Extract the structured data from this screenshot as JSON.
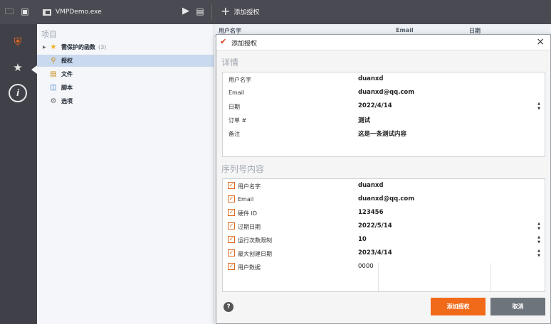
{
  "toolbar": {
    "file_name": "VMPDemo.exe",
    "add_license_label": "添加授权"
  },
  "tree": {
    "heading": "项目",
    "items": [
      {
        "label": "需保护的函数",
        "count": "(3)"
      },
      {
        "label": "授权"
      },
      {
        "label": "文件"
      },
      {
        "label": "脚本"
      },
      {
        "label": "选项"
      }
    ]
  },
  "table_header": {
    "col_user": "用户名字",
    "col_email": "Email",
    "col_date": "日期"
  },
  "dialog": {
    "title": "添加授权",
    "close": "×",
    "details": {
      "title": "详情",
      "rows": [
        {
          "label": "用户名字",
          "value": "duanxd"
        },
        {
          "label": "Email",
          "value": "duanxd@qq.com"
        },
        {
          "label": "日期",
          "value": "2022/4/14"
        },
        {
          "label": "订单 #",
          "value": "测试"
        },
        {
          "label": "备注",
          "value": "这是一条测试内容"
        }
      ]
    },
    "serial": {
      "title": "序列号内容",
      "rows": [
        {
          "label": "用户名字",
          "value": "duanxd",
          "checked": true
        },
        {
          "label": "Email",
          "value": "duanxd@qq.com",
          "checked": true
        },
        {
          "label": "硬件 ID",
          "value": "123456",
          "checked": true
        },
        {
          "label": "过期日期",
          "value": "2022/5/14",
          "checked": true
        },
        {
          "label": "运行次数限制",
          "value": "10",
          "checked": true
        },
        {
          "label": "最大创建日期",
          "value": "2023/4/14",
          "checked": true
        },
        {
          "label": "用户数据",
          "value": "0000",
          "checked": true
        }
      ]
    },
    "help_label": "?",
    "add_button": "添加授权",
    "cancel_button": "取消"
  },
  "colors": {
    "accent": "#f06a1a",
    "topbar": "#4a4a52",
    "rail": "#404048",
    "selection": "#c9d9ee"
  }
}
